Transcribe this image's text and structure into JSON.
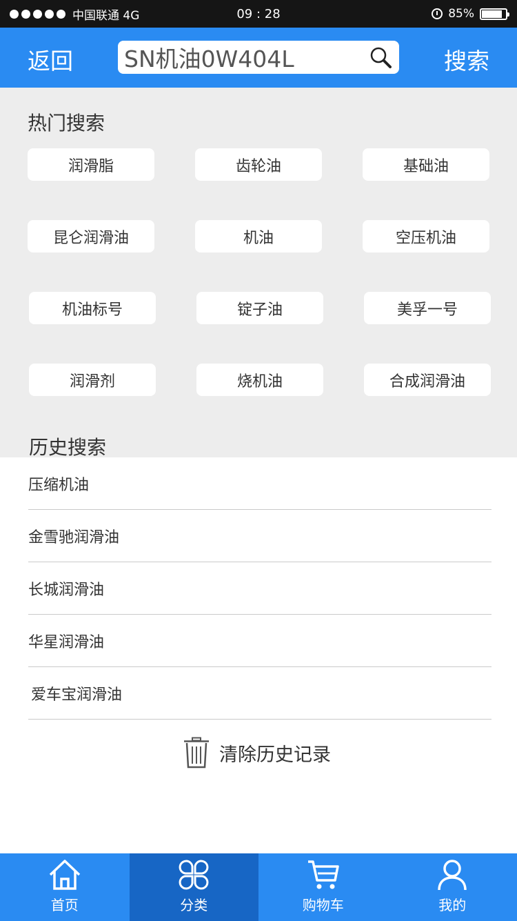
{
  "status_bar": {
    "carrier": "中国联通 4G",
    "time": "09 : 28",
    "battery": "85%",
    "battery_level": 0.85
  },
  "header": {
    "back_label": "返回",
    "search_value": "SN机油0W404L",
    "search_label": "搜索"
  },
  "hot": {
    "title": "热门搜索",
    "tags": [
      "润滑脂",
      "齿轮油",
      "基础油",
      "昆仑润滑油",
      "机油",
      "空压机油",
      "机油标号",
      "锭子油",
      "美孚一号",
      "润滑剂",
      "烧机油",
      "合成润滑油"
    ]
  },
  "history": {
    "title": "历史搜索",
    "items": [
      "压缩机油",
      "金雪驰润滑油",
      "长城润滑油",
      "华星润滑油",
      "爱车宝润滑油"
    ],
    "clear_label": "清除历史记录"
  },
  "tabs": [
    {
      "label": "首页",
      "icon": "home-icon"
    },
    {
      "label": "分类",
      "icon": "category-icon",
      "active": true
    },
    {
      "label": "购物车",
      "icon": "cart-icon"
    },
    {
      "label": "我的",
      "icon": "user-icon"
    }
  ],
  "colors": {
    "primary": "#2a8bf2",
    "active_tab": "#1766c5",
    "hot_bg": "#ededed"
  }
}
